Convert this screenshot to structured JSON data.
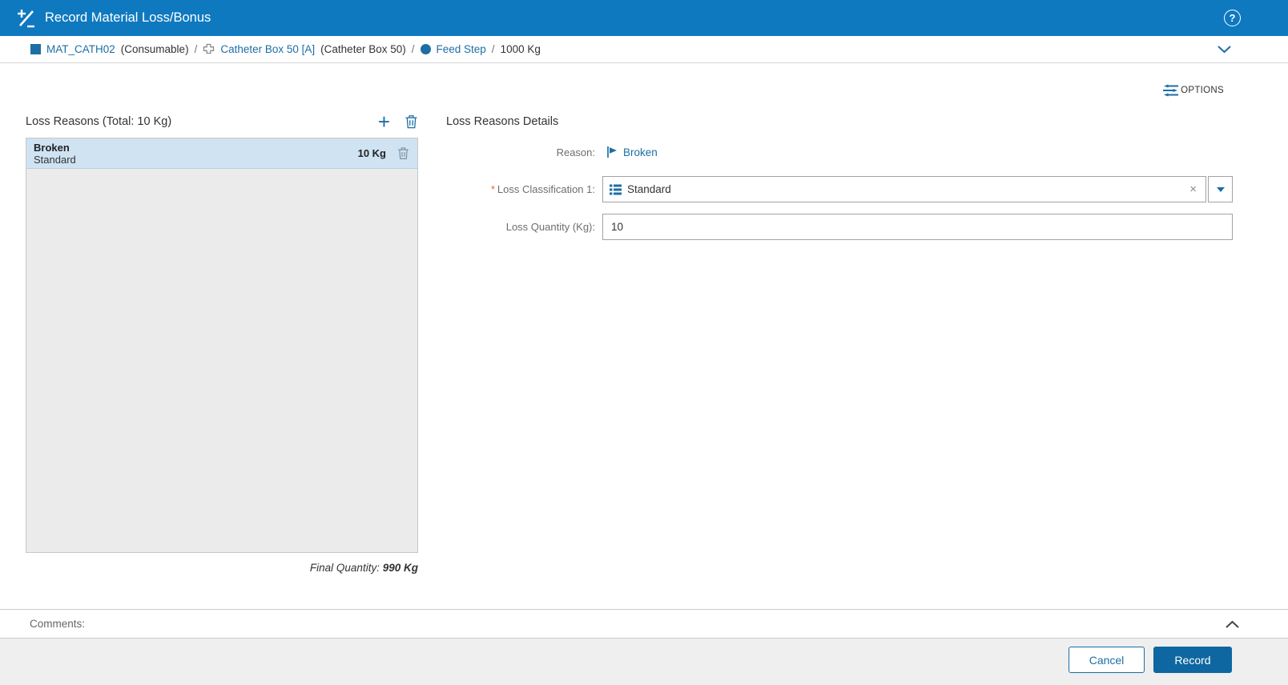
{
  "colors": {
    "header_bg": "#0f79c0",
    "accent_blue": "#1c6ea4",
    "record_button_bg": "#0e67a0",
    "selected_row_bg": "#cfe3f3",
    "panel_bg": "#ebebeb",
    "footer_bg": "#efefef",
    "required_asterisk": "#e0701a"
  },
  "header": {
    "title": "Record Material Loss/Bonus",
    "help_glyph": "?"
  },
  "breadcrumb": {
    "material_name": "MAT_CATH02",
    "material_type": "(Consumable)",
    "sep1": "/",
    "container_name": "Catheter Box 50 [A]",
    "container_desc": "(Catheter Box 50)",
    "sep2": "/",
    "step_name": "Feed Step",
    "sep3": "/",
    "quantity": "1000 Kg"
  },
  "toolbar": {
    "options_label": "OPTIONS",
    "add_glyph": "+"
  },
  "loss_reasons_panel": {
    "title": "Loss Reasons (Total: 10 Kg)",
    "items": [
      {
        "reason": "Broken",
        "classification": "Standard",
        "quantity": "10 Kg"
      }
    ],
    "final_quantity_label": "Final Quantity:",
    "final_quantity_value": "990 Kg"
  },
  "details_panel": {
    "title": "Loss Reasons Details",
    "reason": {
      "label": "Reason:",
      "value": "Broken"
    },
    "classification": {
      "required_marker": "*",
      "label": "Loss Classification 1:",
      "value": "Standard",
      "clear_glyph": "×"
    },
    "quantity": {
      "label": "Loss Quantity (Kg):",
      "value": "10"
    }
  },
  "comments": {
    "label": "Comments:"
  },
  "footer": {
    "cancel_label": "Cancel",
    "record_label": "Record"
  }
}
